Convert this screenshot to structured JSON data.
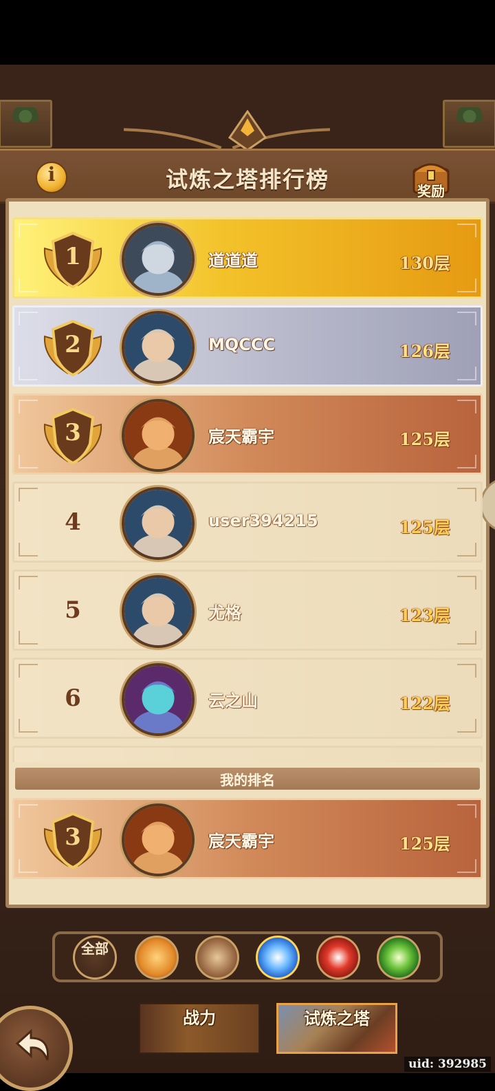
{
  "header": {
    "title": "试炼之塔排行榜",
    "info_icon": "i",
    "reward_label": "奖励"
  },
  "leaderboard": [
    {
      "rank": "1",
      "name": "道道道",
      "floor": "130层",
      "style": "gold",
      "avatar": "elf-hero"
    },
    {
      "rank": "2",
      "name": "MQCCC",
      "floor": "126层",
      "style": "silver",
      "avatar": "engineer-hero"
    },
    {
      "rank": "3",
      "name": "宸天霸宇",
      "floor": "125层",
      "style": "bronze",
      "avatar": "dwarf-hero"
    },
    {
      "rank": "4",
      "name": "user394215",
      "floor": "125层",
      "style": "plain",
      "avatar": "engineer-hero"
    },
    {
      "rank": "5",
      "name": "尤格",
      "floor": "123层",
      "style": "plain",
      "avatar": "engineer-hero"
    },
    {
      "rank": "6",
      "name": "云之山",
      "floor": "122层",
      "style": "plain",
      "avatar": "dragon-hero"
    }
  ],
  "my_rank": {
    "label": "我的排名",
    "rank": "3",
    "name": "宸天霸宇",
    "floor": "125层",
    "style": "bronze",
    "avatar": "dwarf-hero"
  },
  "filters": {
    "all_label": "全部",
    "factions": [
      "faction-light-icon",
      "faction-earth-icon",
      "faction-water-icon",
      "faction-fire-icon",
      "faction-nature-icon"
    ]
  },
  "tabs": {
    "power": "战力",
    "tower": "试炼之塔"
  },
  "uid": "uid: 392985",
  "colors": {
    "gold": "#f3c22a",
    "silver": "#b7b8ca",
    "bronze": "#d28a5a",
    "parchment": "#efe0c0",
    "frame_brown": "#3b261b"
  }
}
